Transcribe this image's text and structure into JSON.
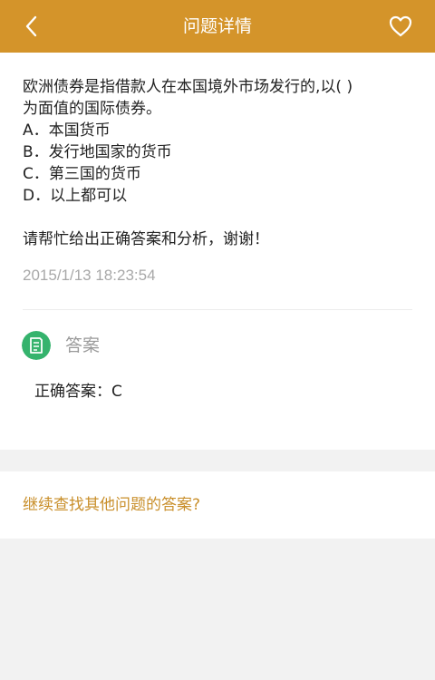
{
  "header": {
    "title": "问题详情",
    "back_icon": "chevron-left-icon",
    "favorite_icon": "heart-icon"
  },
  "question": {
    "stem_line1": "欧洲债券是指借款人在本国境外市场发行的,以( )",
    "stem_line2": "为面值的国际债券。",
    "options": [
      "A．本国货币",
      "B．发行地国家的货币",
      "C．第三国的货币",
      "D．以上都可以"
    ],
    "request": "请帮忙给出正确答案和分析，谢谢！",
    "timestamp": "2015/1/13 18:23:54"
  },
  "answer": {
    "heading": "答案",
    "icon": "answer-document-icon",
    "text": "正确答案：C"
  },
  "more": {
    "link_label": "继续查找其他问题的答案?"
  },
  "colors": {
    "header_bg": "#d4942a",
    "answer_icon_bg": "#35b36d",
    "link": "#c98f2b",
    "page_bg": "#f2f2f2"
  }
}
